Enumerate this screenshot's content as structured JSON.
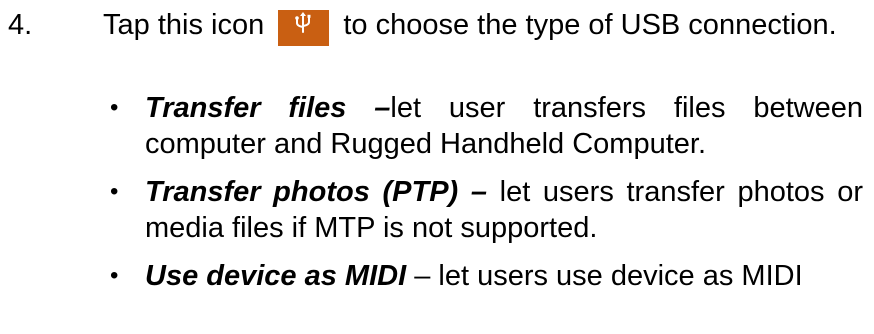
{
  "step": {
    "number": "4.",
    "text_before_icon": "Tap this icon",
    "icon": "usb-icon",
    "icon_color": "#c95f12",
    "text_after_icon": "to choose the type of USB connection."
  },
  "bullets": [
    {
      "term": "Transfer files –",
      "description": "let user transfers files between computer and Rugged Handheld Computer."
    },
    {
      "term": "Transfer photos (PTP) –",
      "description": " let users transfer photos or media files if MTP is not supported."
    },
    {
      "term": "Use device as MIDI",
      "description": " – let users use device as MIDI"
    }
  ]
}
